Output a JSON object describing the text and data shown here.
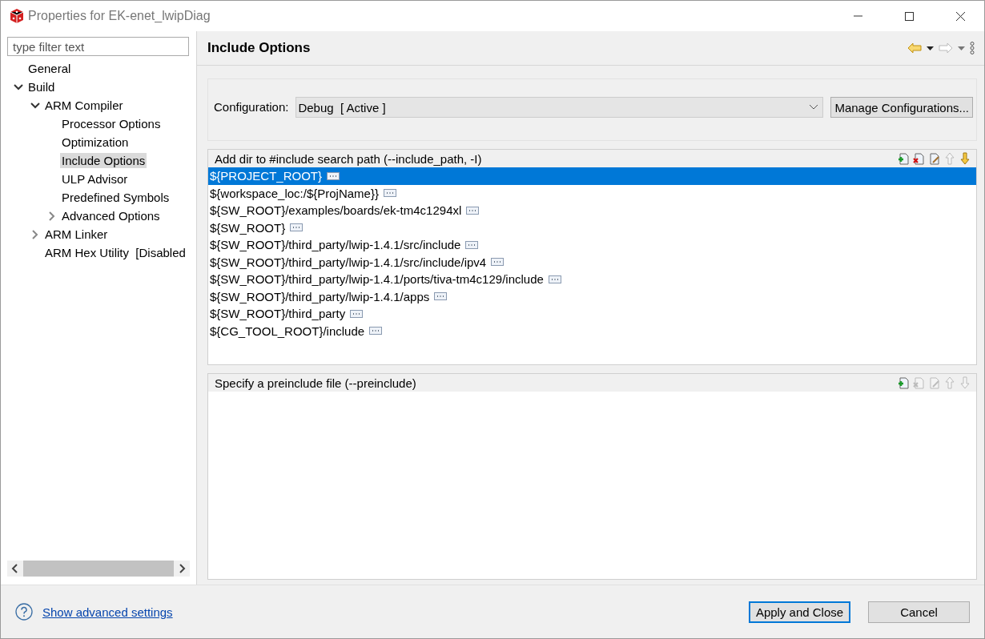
{
  "window": {
    "title": "Properties for EK-enet_lwipDiag"
  },
  "sidebar": {
    "filter": {
      "placeholder": "type filter text"
    },
    "tree": [
      {
        "label": "General",
        "selected": false
      },
      {
        "label": "Build",
        "selected": false,
        "expanded": true,
        "children": [
          {
            "label": "ARM Compiler",
            "selected": false,
            "expanded": true,
            "children": [
              {
                "label": "Processor Options",
                "selected": false
              },
              {
                "label": "Optimization",
                "selected": false
              },
              {
                "label": "Include Options",
                "selected": true
              },
              {
                "label": "ULP Advisor",
                "selected": false
              },
              {
                "label": "Predefined Symbols",
                "selected": false
              },
              {
                "label": "Advanced Options",
                "selected": false,
                "expanded": false
              }
            ]
          },
          {
            "label": "ARM Linker",
            "selected": false,
            "expanded": false
          },
          {
            "label": "ARM Hex Utility  [Disabled",
            "selected": false
          }
        ]
      }
    ]
  },
  "page": {
    "title": "Include Options",
    "nav": {
      "back_disabled": false,
      "forward_disabled": true
    },
    "configuration": {
      "label": "Configuration:",
      "value": "Debug  [ Active ]",
      "button": "Manage Configurations..."
    },
    "lists": [
      {
        "title": "Add dir to #include search path (--include_path, -I)",
        "tools": [
          {
            "kind": "add",
            "disabled": false
          },
          {
            "kind": "delete",
            "disabled": false
          },
          {
            "kind": "edit",
            "disabled": false
          },
          {
            "kind": "up",
            "disabled": true
          },
          {
            "kind": "down",
            "disabled": false
          }
        ],
        "rows": [
          {
            "text": "${PROJECT_ROOT}",
            "selected": true
          },
          {
            "text": "${workspace_loc:/${ProjName}}",
            "selected": false
          },
          {
            "text": "${SW_ROOT}/examples/boards/ek-tm4c1294xl",
            "selected": false
          },
          {
            "text": "${SW_ROOT}",
            "selected": false
          },
          {
            "text": "${SW_ROOT}/third_party/lwip-1.4.1/src/include",
            "selected": false
          },
          {
            "text": "${SW_ROOT}/third_party/lwip-1.4.1/src/include/ipv4",
            "selected": false
          },
          {
            "text": "${SW_ROOT}/third_party/lwip-1.4.1/ports/tiva-tm4c129/include",
            "selected": false
          },
          {
            "text": "${SW_ROOT}/third_party/lwip-1.4.1/apps",
            "selected": false
          },
          {
            "text": "${SW_ROOT}/third_party",
            "selected": false
          },
          {
            "text": "${CG_TOOL_ROOT}/include",
            "selected": false
          }
        ]
      },
      {
        "title": "Specify a preinclude file (--preinclude)",
        "tools": [
          {
            "kind": "add",
            "disabled": false
          },
          {
            "kind": "delete",
            "disabled": true
          },
          {
            "kind": "edit",
            "disabled": true
          },
          {
            "kind": "up",
            "disabled": true
          },
          {
            "kind": "down",
            "disabled": true
          }
        ]
      }
    ]
  },
  "footer": {
    "link": "Show advanced settings",
    "buttons": [
      {
        "label": "Apply and Close",
        "default": true
      },
      {
        "label": "Cancel",
        "default": false
      }
    ]
  }
}
